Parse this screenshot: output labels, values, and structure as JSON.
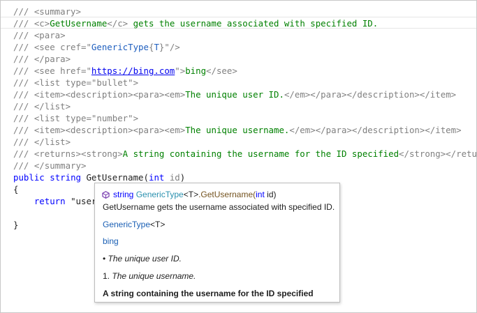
{
  "editor": {
    "lines": [
      {
        "parts": [
          [
            "g",
            "/// "
          ],
          [
            "g",
            "<summary>"
          ]
        ]
      },
      {
        "parts": [
          [
            "g",
            "/// "
          ],
          [
            "g",
            "<c>"
          ],
          [
            "c",
            "GetUsername"
          ],
          [
            "g",
            "</c>"
          ],
          [
            "c",
            " gets the username associated with specified ID."
          ]
        ]
      },
      {
        "parts": [
          [
            "g",
            "/// "
          ],
          [
            "g",
            "<para>"
          ]
        ]
      },
      {
        "parts": [
          [
            "g",
            "/// "
          ],
          [
            "g",
            "<see cref=\""
          ],
          [
            "av",
            "GenericType"
          ],
          [
            "g",
            "{"
          ],
          [
            "av",
            "T"
          ],
          [
            "g",
            "}\"/>"
          ]
        ]
      },
      {
        "parts": [
          [
            "g",
            "/// "
          ],
          [
            "g",
            "</para>"
          ]
        ]
      },
      {
        "parts": [
          [
            "g",
            "/// "
          ],
          [
            "g",
            "<see href=\""
          ],
          [
            "lnk",
            "https://bing.com"
          ],
          [
            "g",
            "\">"
          ],
          [
            "c",
            "bing"
          ],
          [
            "g",
            "</see>"
          ]
        ]
      },
      {
        "parts": [
          [
            "g",
            "/// "
          ],
          [
            "g",
            "<list type=\"bullet\">"
          ]
        ]
      },
      {
        "parts": [
          [
            "g",
            "/// "
          ],
          [
            "g",
            "<item><description><para><em>"
          ],
          [
            "c",
            "The unique user ID."
          ],
          [
            "g",
            "</em></para></description></item>"
          ]
        ]
      },
      {
        "parts": [
          [
            "g",
            "/// "
          ],
          [
            "g",
            "</list>"
          ]
        ]
      },
      {
        "parts": [
          [
            "g",
            "/// "
          ],
          [
            "g",
            "<list type=\"number\">"
          ]
        ]
      },
      {
        "parts": [
          [
            "g",
            "/// "
          ],
          [
            "g",
            "<item><description><para><em>"
          ],
          [
            "c",
            "The unique username."
          ],
          [
            "g",
            "</em></para></description></item>"
          ]
        ]
      },
      {
        "parts": [
          [
            "g",
            "/// "
          ],
          [
            "g",
            "</list>"
          ]
        ]
      },
      {
        "parts": [
          [
            "g",
            "/// "
          ],
          [
            "g",
            "<returns><strong>"
          ],
          [
            "c",
            "A string containing the username for the ID specified"
          ],
          [
            "g",
            "</strong></returns>"
          ]
        ]
      },
      {
        "parts": [
          [
            "g",
            "/// "
          ],
          [
            "g",
            "</summary>"
          ]
        ]
      },
      {
        "parts": [
          [
            "k",
            "public"
          ],
          [
            "t",
            " "
          ],
          [
            "k",
            "string"
          ],
          [
            "t",
            " GetUsername("
          ],
          [
            "k",
            "int"
          ],
          [
            "t",
            " "
          ],
          [
            "g",
            "id"
          ],
          [
            "t",
            ")"
          ]
        ]
      },
      {
        "parts": [
          [
            "t",
            "{"
          ]
        ]
      },
      {
        "parts": [
          [
            "t",
            "    "
          ],
          [
            "k",
            "return"
          ],
          [
            "t",
            " \"userr"
          ]
        ]
      },
      {
        "parts": [
          [
            "t",
            ""
          ]
        ]
      },
      {
        "parts": [
          [
            "t",
            "}"
          ]
        ]
      }
    ]
  },
  "tooltip": {
    "signature": {
      "icon": "method-cube-icon",
      "return_type": "string",
      "type_name": "GenericType",
      "type_param": "<T>",
      "method": ".GetUsername(",
      "param_kw": "int",
      "param_name": " id)"
    },
    "summary": "GetUsername gets the username associated with specified ID.",
    "cref_type": "GenericType",
    "cref_param": "<T>",
    "link_text": "bing",
    "bullet_item": "The unique user ID.",
    "bullet_marker": "•",
    "number_marker": "1.",
    "number_item": "The unique username.",
    "returns": "A string containing the username for the ID specified",
    "colors": {
      "keyword": "#0000ff",
      "type": "#2b91af",
      "link": "#1a5fb4",
      "method_icon": "#7a3eb0"
    }
  }
}
